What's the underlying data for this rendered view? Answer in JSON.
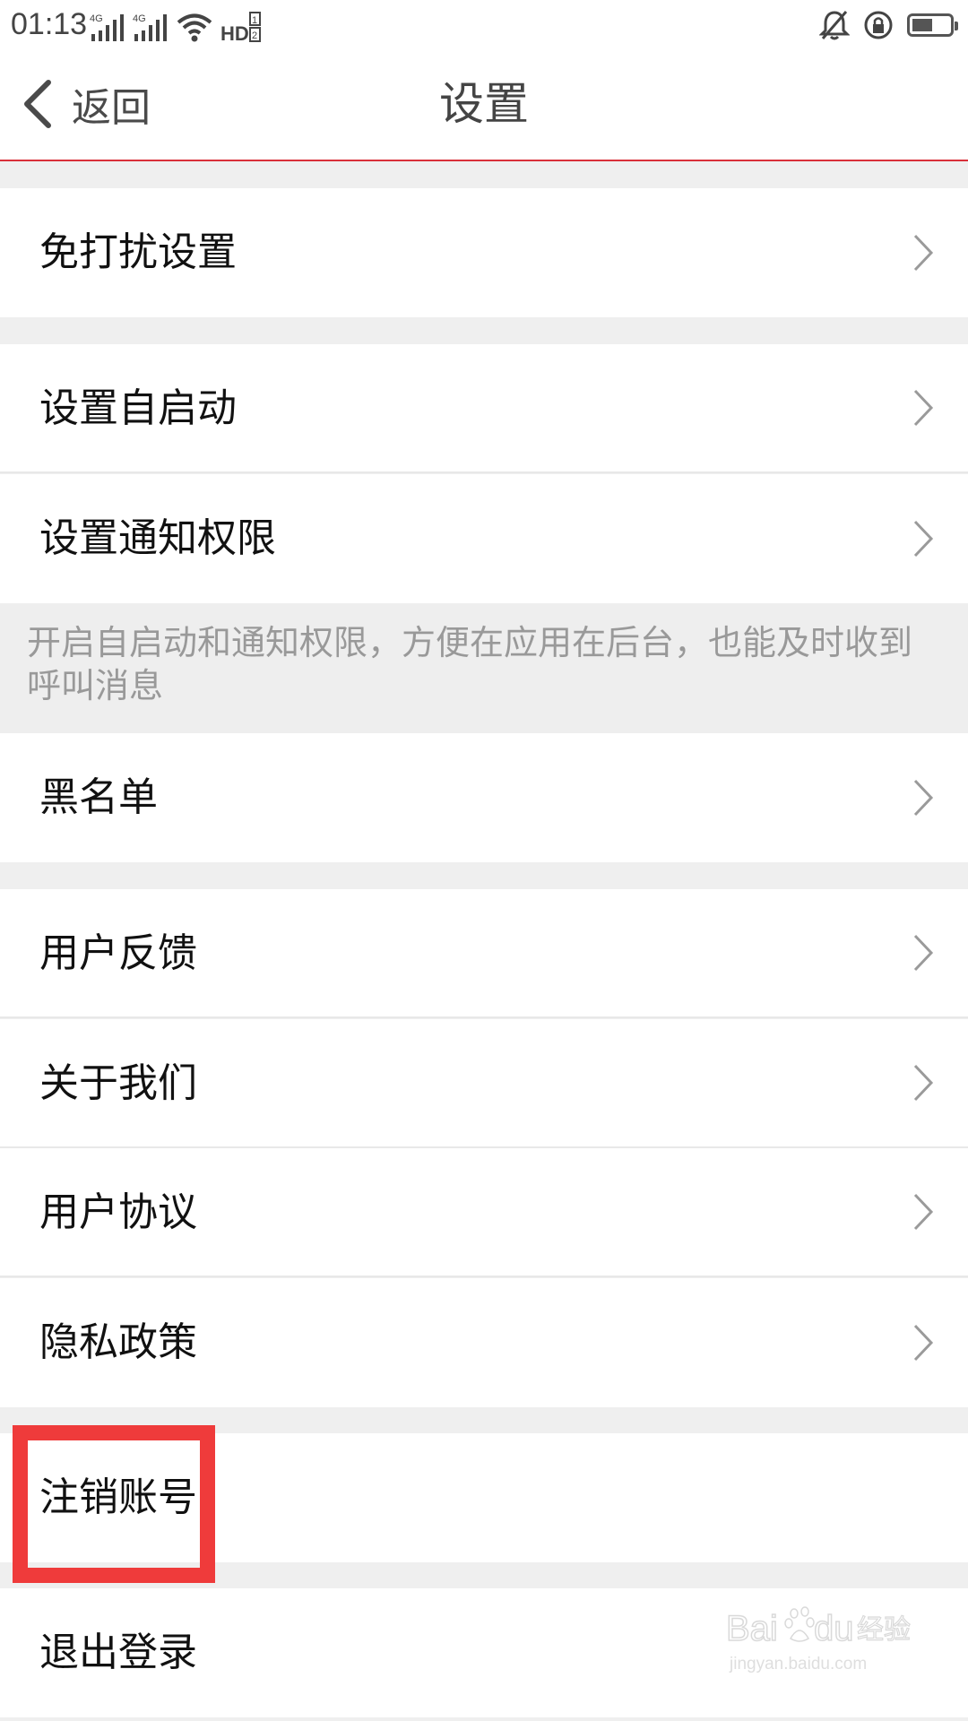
{
  "status_bar": {
    "time": "01:13",
    "network_1": "4G",
    "network_2": "4G",
    "hd_label": "HD",
    "icons": [
      "signal-icon",
      "signal-icon",
      "wifi-icon",
      "hd-icon",
      "silent-bell-icon",
      "rotation-lock-icon",
      "battery-icon"
    ]
  },
  "nav": {
    "back_label": "返回",
    "title": "设置"
  },
  "settings": {
    "do_not_disturb": "免打扰设置",
    "autostart": "设置自启动",
    "notification_permission": "设置通知权限",
    "hint": "开启自启动和通知权限，方便在应用在后台，也能及时收到呼叫消息",
    "blacklist": "黑名单",
    "feedback": "用户反馈",
    "about_us": "关于我们",
    "user_agreement": "用户协议",
    "privacy_policy": "隐私政策",
    "deactivate_account": "注销账号",
    "logout": "退出登录"
  },
  "colors": {
    "accent_line": "#d9303a",
    "highlight_box": "#ef3b3b",
    "page_background": "#efefef",
    "row_background": "#ffffff"
  },
  "watermark": {
    "brand": "Bai",
    "brand_suffix": "du",
    "brand_cn": "经验",
    "url": "jingyan.baidu.com"
  }
}
